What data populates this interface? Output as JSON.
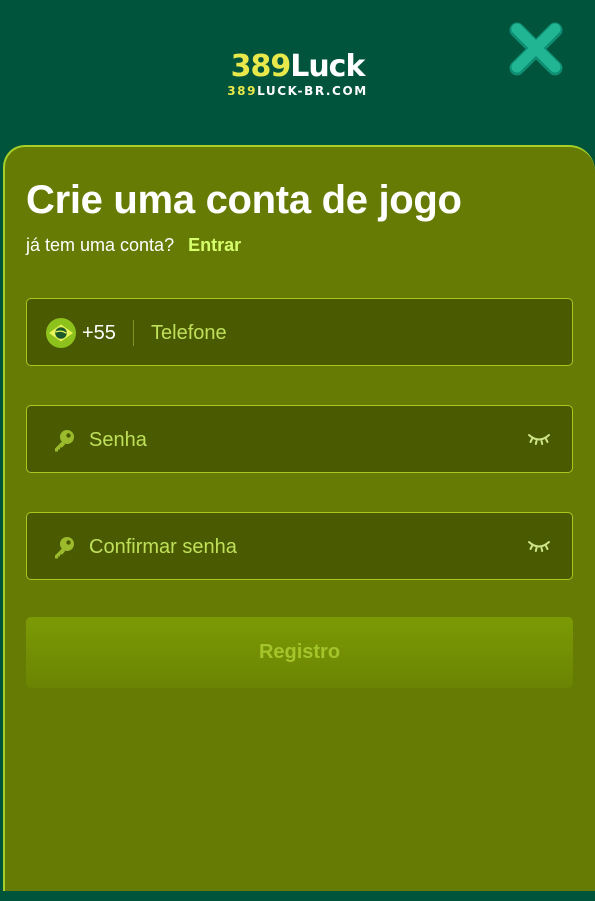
{
  "header": {
    "logo_number": "389",
    "logo_word": "Luck",
    "logo_sub_number": "389",
    "logo_sub_rest": "LUCK-BR.COM",
    "close_icon": "close-icon",
    "close_color": "#1fa98b"
  },
  "form": {
    "title": "Crie uma conta de jogo",
    "login_prompt": "já tem uma conta?",
    "login_link": "Entrar",
    "phone": {
      "flag_icon": "brazil-flag-icon",
      "country_code": "+55",
      "value": "",
      "placeholder": "Telefone"
    },
    "password": {
      "icon": "key-icon",
      "value": "",
      "placeholder": "Senha",
      "toggle_icon": "eye-closed-icon"
    },
    "confirm_password": {
      "icon": "key-icon",
      "value": "",
      "placeholder": "Confirmar senha",
      "toggle_icon": "eye-closed-icon"
    },
    "submit_label": "Registro"
  },
  "colors": {
    "header_bg": "#00543c",
    "panel_bg": "#667b03",
    "accent": "#d6ff6b",
    "field_bg": "#4a5a00",
    "field_border": "#a8c81e"
  }
}
